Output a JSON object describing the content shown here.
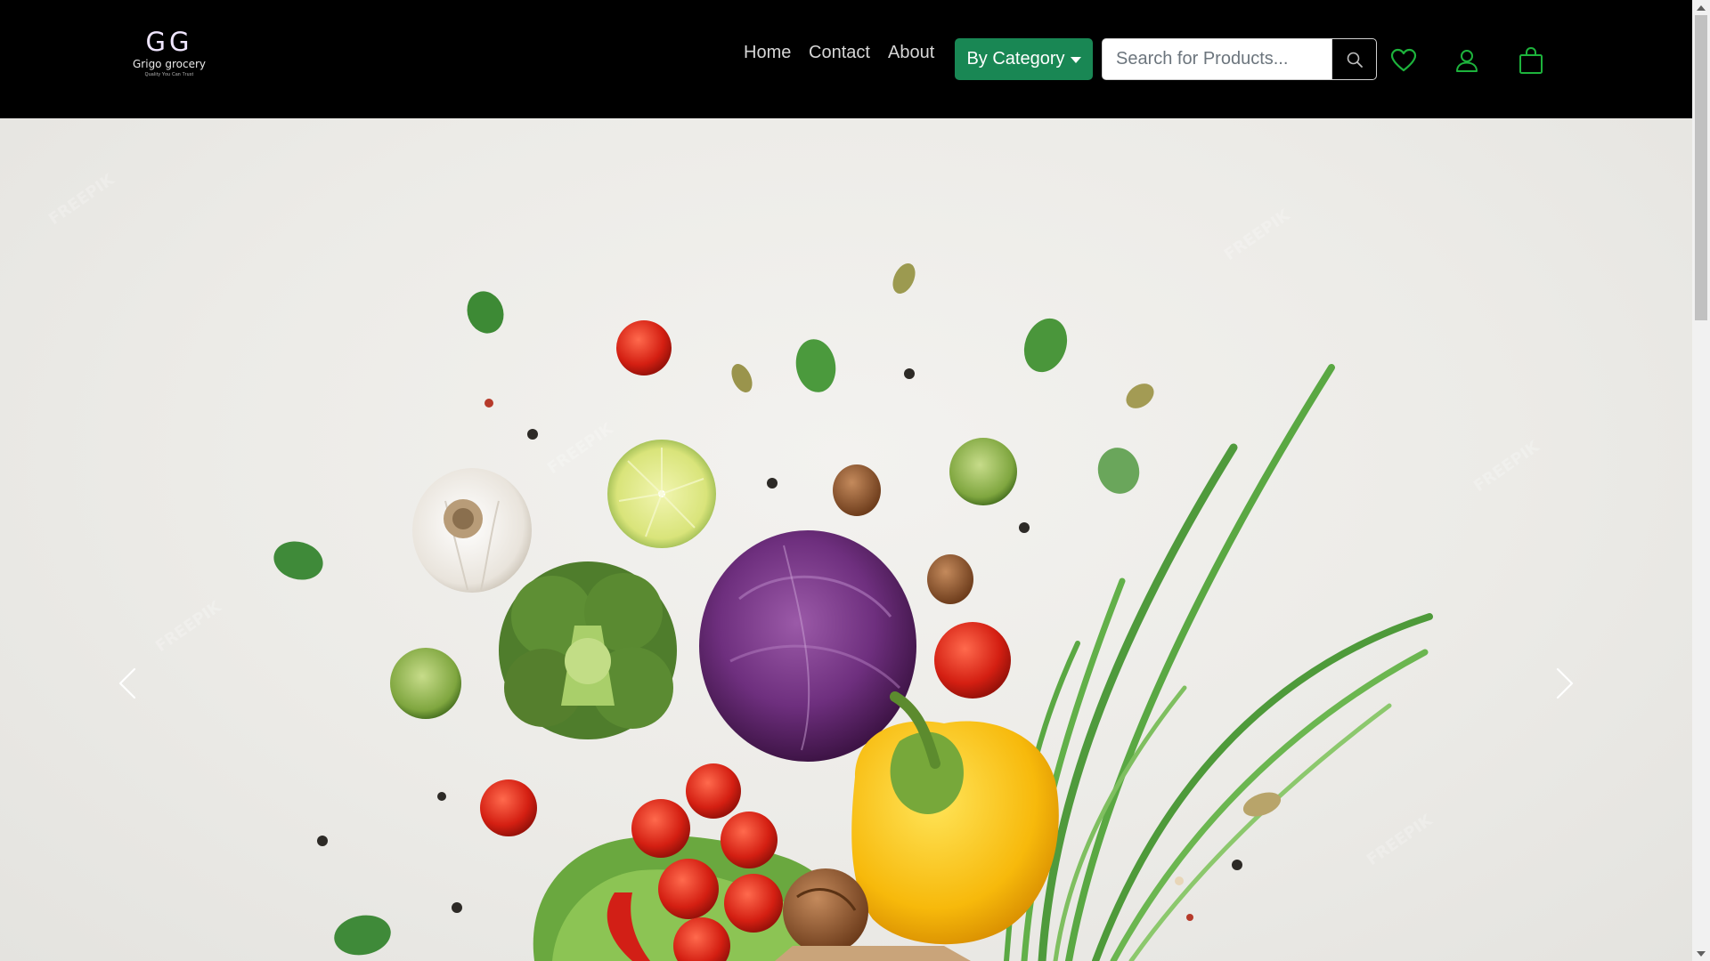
{
  "brand": {
    "mark": "GG",
    "name": "Grigo grocery",
    "tagline": "Quality You Can Trust"
  },
  "nav": {
    "home": "Home",
    "contact": "Contact",
    "about": "About",
    "category_button": "By Category"
  },
  "search": {
    "placeholder": "Search for Products..."
  },
  "icons": {
    "search": "search-icon",
    "wishlist": "heart-icon",
    "account": "user-icon",
    "cart": "shopping-bag-icon",
    "carousel_prev": "chevron-left-icon",
    "carousel_next": "chevron-right-icon"
  },
  "colors": {
    "navbar_bg": "#000000",
    "accent_green": "#198754",
    "icon_green": "#1db33c"
  }
}
